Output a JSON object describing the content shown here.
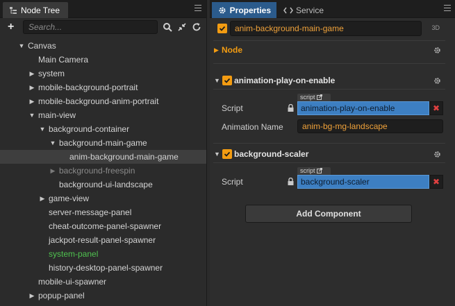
{
  "tree_panel": {
    "tab_label": "Node Tree",
    "search_placeholder": "Search...",
    "nodes": [
      {
        "label": "Canvas",
        "depth": 1,
        "arrow": "open"
      },
      {
        "label": "Main Camera",
        "depth": 2,
        "arrow": "none"
      },
      {
        "label": "system",
        "depth": 2,
        "arrow": "closed"
      },
      {
        "label": "mobile-background-portrait",
        "depth": 2,
        "arrow": "closed"
      },
      {
        "label": "mobile-background-anim-portrait",
        "depth": 2,
        "arrow": "closed"
      },
      {
        "label": "main-view",
        "depth": 2,
        "arrow": "open"
      },
      {
        "label": "background-container",
        "depth": 3,
        "arrow": "open"
      },
      {
        "label": "background-main-game",
        "depth": 4,
        "arrow": "open"
      },
      {
        "label": "anim-background-main-game",
        "depth": 5,
        "arrow": "none",
        "selected": true
      },
      {
        "label": "background-freespin",
        "depth": 4,
        "arrow": "closed",
        "dim": true
      },
      {
        "label": "background-ui-landscape",
        "depth": 4,
        "arrow": "none"
      },
      {
        "label": "game-view",
        "depth": 3,
        "arrow": "closed"
      },
      {
        "label": "server-message-panel",
        "depth": 3,
        "arrow": "none"
      },
      {
        "label": "cheat-outcome-panel-spawner",
        "depth": 3,
        "arrow": "none"
      },
      {
        "label": "jackpot-result-panel-spawner",
        "depth": 3,
        "arrow": "none"
      },
      {
        "label": "system-panel",
        "depth": 3,
        "arrow": "none",
        "green": true
      },
      {
        "label": "history-desktop-panel-spawner",
        "depth": 3,
        "arrow": "none"
      },
      {
        "label": "mobile-ui-spawner",
        "depth": 2,
        "arrow": "none"
      },
      {
        "label": "popup-panel",
        "depth": 2,
        "arrow": "closed"
      }
    ]
  },
  "props_panel": {
    "tab_properties": "Properties",
    "tab_service": "Service",
    "node_name": "anim-background-main-game",
    "tag_3d": "3D",
    "node_section": "Node",
    "components": [
      {
        "title": "animation-play-on-enable",
        "script_label": "Script",
        "script_tag": "script",
        "script_value": "animation-play-on-enable",
        "extra_label": "Animation Name",
        "extra_value": "anim-bg-mg-landscape"
      },
      {
        "title": "background-scaler",
        "script_label": "Script",
        "script_tag": "script",
        "script_value": "background-scaler"
      }
    ],
    "add_component": "Add Component",
    "remove_symbol": "✖"
  },
  "colors": {
    "accent_orange": "#f39c12",
    "selected_tab_blue": "#2b5b8c",
    "asset_blue": "#3d7fc2",
    "active_node_green": "#4fc24f"
  }
}
